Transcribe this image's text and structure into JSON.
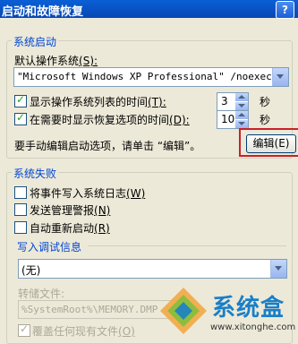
{
  "window": {
    "title": "启动和故障恢复",
    "help_label": "?"
  },
  "startup": {
    "group_label": "系统启动",
    "default_os_label": "默认操作系统",
    "default_os_key": "(S):",
    "default_os_value": "\"Microsoft Windows XP Professional\" /noexecute=optin",
    "show_os_list_label": "显示操作系统列表的时间",
    "show_os_list_key": "(T):",
    "show_os_list_checked": true,
    "show_os_list_value": "3",
    "show_os_list_unit": "秒",
    "show_recovery_label": "在需要时显示恢复选项的时间",
    "show_recovery_key": "(D):",
    "show_recovery_checked": true,
    "show_recovery_value": "10",
    "show_recovery_unit": "秒",
    "edit_hint": "要手动编辑启动选项，请单击 “编辑”。",
    "edit_button": "编辑(E)"
  },
  "failure": {
    "group_label": "系统失败",
    "write_event_log": "将事件写入系统日志",
    "write_event_log_key": "(W)",
    "send_alert": "发送管理警报",
    "send_alert_key": "(N)",
    "auto_restart": "自动重新启动",
    "auto_restart_key": "(R)",
    "debug_group_label": "写入调试信息",
    "debug_selected": "(无)",
    "dump_file_label": "转储文件:",
    "dump_file_value": "%SystemRoot%\\MEMORY.DMP",
    "overwrite_label": "覆盖任何现有文件",
    "overwrite_key": "(O)",
    "overwrite_checked": true
  },
  "watermark": {
    "text": "系统盒",
    "url": "www.xitonghe.com"
  }
}
